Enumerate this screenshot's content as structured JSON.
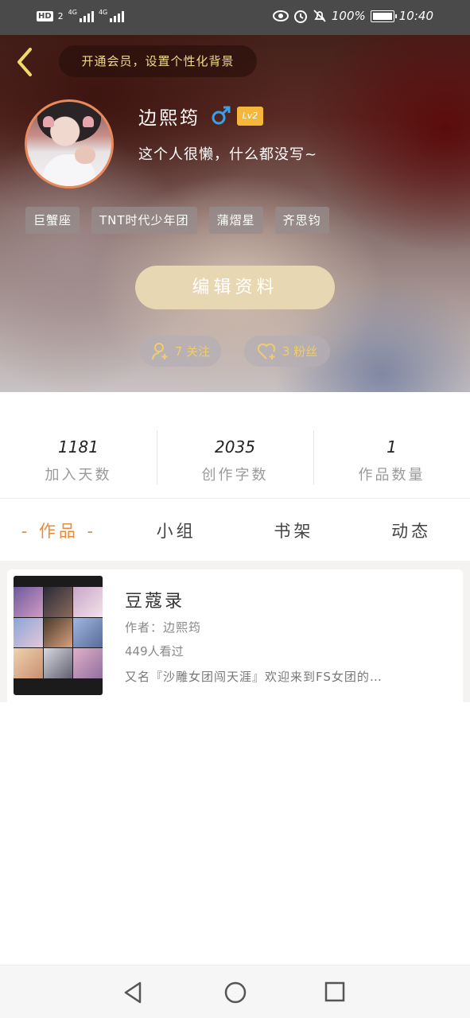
{
  "status_bar": {
    "hd": "HD",
    "sim_badge": "2",
    "net1": "4G",
    "net2": "4G",
    "battery": "100%",
    "time": "10:40"
  },
  "header": {
    "vip_banner": "开通会员，设置个性化背景",
    "username": "边熙筠",
    "level": "Lv2",
    "bio": "这个人很懒，什么都没写~",
    "tags": [
      "巨蟹座",
      "TNT时代少年团",
      "蒲熠星",
      "齐思钧"
    ],
    "edit_button": "编辑资料",
    "following_text": "7 关注",
    "fans_text": "3 粉丝"
  },
  "stats": [
    {
      "value": "1181",
      "label": "加入天数"
    },
    {
      "value": "2035",
      "label": "创作字数"
    },
    {
      "value": "1",
      "label": "作品数量"
    }
  ],
  "tabs": [
    {
      "label": "- 作品 -",
      "active": true
    },
    {
      "label": "小组",
      "active": false
    },
    {
      "label": "书架",
      "active": false
    },
    {
      "label": "动态",
      "active": false
    }
  ],
  "works": [
    {
      "title": "豆蔻录",
      "author": "作者：边熙筠",
      "views": "449人看过",
      "description": "又名『沙雕女团闯天涯』欢迎来到FS女团的…"
    }
  ],
  "colors": {
    "accent": "#e98a3c",
    "vip_text": "#f0d98a",
    "pill_text": "#f0cd6a",
    "edit_button_bg": "#e8d7b3",
    "level_badge": "#f4b63b",
    "male_icon": "#3aa0e8"
  },
  "icons": {
    "back": "chevron-left-icon",
    "gender": "male-icon",
    "following": "person-add-icon",
    "fans": "heart-add-icon",
    "nav_back": "triangle-back-icon",
    "nav_home": "circle-home-icon",
    "nav_recent": "square-recent-icon"
  }
}
